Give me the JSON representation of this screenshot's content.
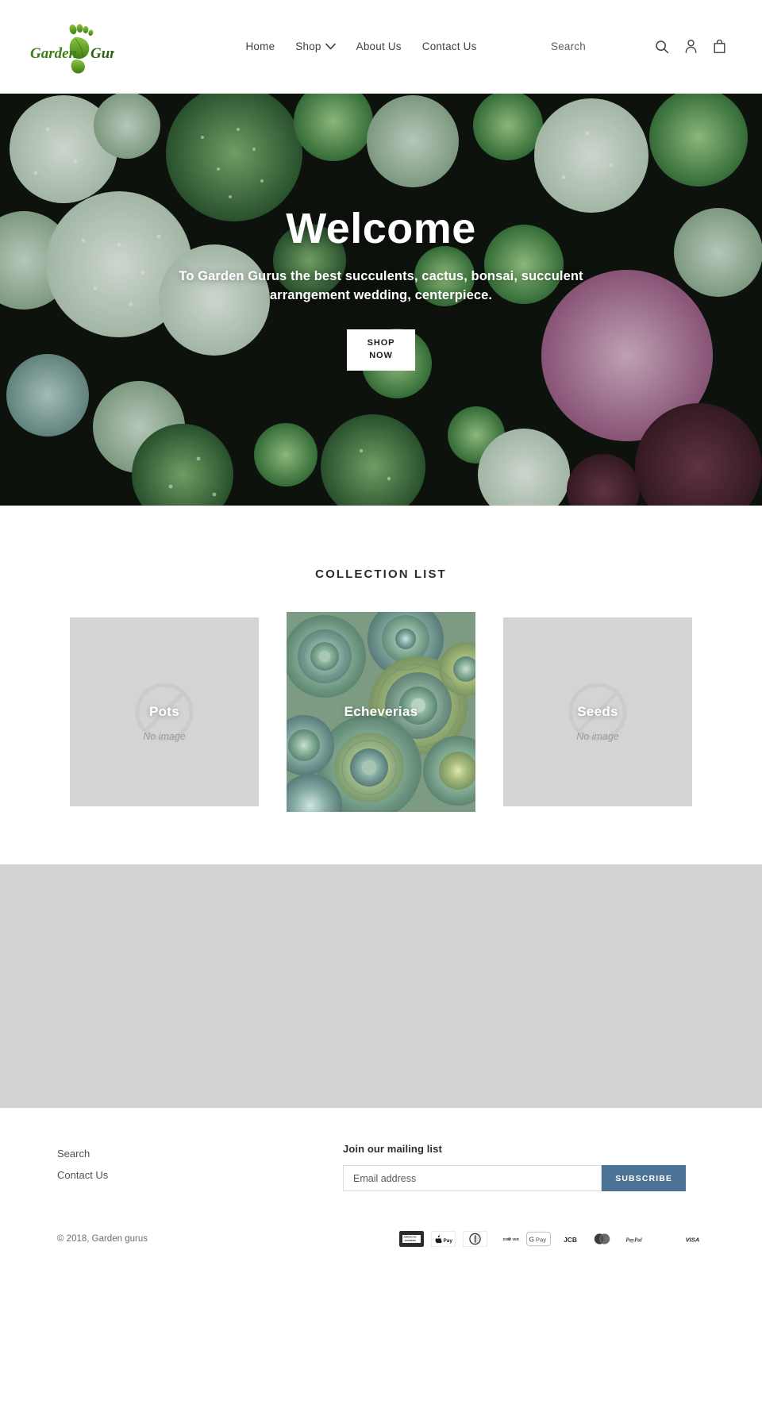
{
  "header": {
    "logo_alt": "Garden Guru",
    "logo_text_left": "Garden",
    "logo_text_right": "Guru",
    "nav": [
      {
        "label": "Home",
        "has_dropdown": false
      },
      {
        "label": "Shop",
        "has_dropdown": true
      },
      {
        "label": "About Us",
        "has_dropdown": false
      },
      {
        "label": "Contact Us",
        "has_dropdown": false
      }
    ],
    "search_label": "Search",
    "icons": {
      "search": "search-icon",
      "account": "account-icon",
      "cart": "cart-icon"
    }
  },
  "hero": {
    "title": "Welcome",
    "subtitle": "To Garden Gurus the best succulents, cactus, bonsai, succulent arrangement wedding, centerpiece.",
    "button_line1": "SHOP",
    "button_line2": "NOW"
  },
  "collections": {
    "title": "COLLECTION LIST",
    "no_image_text": "No image",
    "items": [
      {
        "label": "Pots",
        "has_image": false
      },
      {
        "label": "Echeverias",
        "has_image": true
      },
      {
        "label": "Seeds",
        "has_image": false
      }
    ]
  },
  "footer": {
    "links": [
      {
        "label": "Search"
      },
      {
        "label": "Contact Us"
      }
    ],
    "newsletter": {
      "title": "Join our mailing list",
      "email_placeholder": "Email address",
      "email_value": "",
      "subscribe_label": "SUBSCRIBE",
      "accent_color": "#4a7396"
    },
    "copyright": "© 2018, Garden gurus",
    "payment_methods": [
      {
        "name": "american-express",
        "label": "AMERICAN EXPRESS"
      },
      {
        "name": "apple-pay",
        "label": "Pay"
      },
      {
        "name": "diners-club",
        "label": "Diners Club"
      },
      {
        "name": "discover",
        "label": "DISCOVER"
      },
      {
        "name": "google-pay",
        "label": "G Pay"
      },
      {
        "name": "jcb",
        "label": "JCB"
      },
      {
        "name": "mastercard",
        "label": "Mastercard"
      },
      {
        "name": "paypal",
        "label": "PayPal"
      },
      {
        "name": "visa",
        "label": "VISA"
      }
    ]
  },
  "colors": {
    "brand_green": "#5a9b2f",
    "text": "#3a3a3a",
    "accent": "#4a7396",
    "placeholder_gray": "#d1d3d4"
  }
}
